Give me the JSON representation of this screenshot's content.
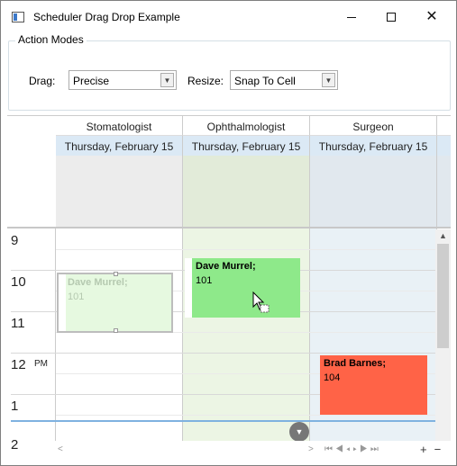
{
  "window": {
    "title": "Scheduler Drag Drop Example"
  },
  "action_modes": {
    "title": "Action Modes",
    "drag_label": "Drag:",
    "drag_value": "Precise",
    "resize_label": "Resize:",
    "resize_value": "Snap To Cell"
  },
  "resources": [
    {
      "name": "Stomatologist",
      "date": "Thursday, February 15"
    },
    {
      "name": "Ophthalmologist",
      "date": "Thursday, February 15"
    },
    {
      "name": "Surgeon",
      "date": "Thursday, February 15"
    }
  ],
  "hours": [
    "9",
    "10",
    "11",
    "12",
    "1",
    "2"
  ],
  "ampm": "PM",
  "appointments": {
    "ghost": {
      "subject": "Dave Murrel;",
      "location": "101"
    },
    "dragged": {
      "subject": "Dave Murrel;",
      "location": "101",
      "color": "#8ee98a"
    },
    "surgeon": {
      "subject": "Brad Barnes;",
      "location": "104",
      "color": "#ff6347"
    }
  },
  "colors": {
    "date_header": "#dbe9f5",
    "col_ophthalmologist": "#ecf5e4",
    "col_surgeon": "#e9f1f6",
    "now_line": "#7fb2e0"
  }
}
